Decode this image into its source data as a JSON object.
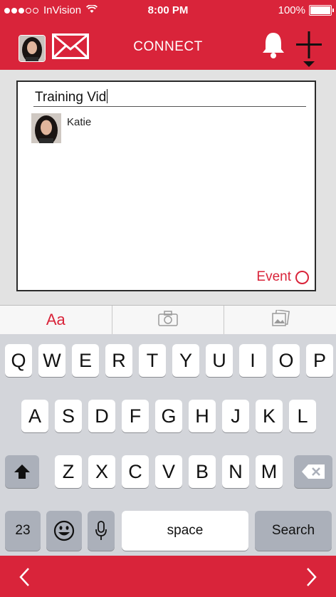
{
  "status_bar": {
    "carrier": "InVision",
    "time": "8:00 PM",
    "battery": "100%",
    "battery_level": 1.0,
    "signal_dots_filled": 3,
    "signal_dots_total": 5
  },
  "nav": {
    "title": "CONNECT"
  },
  "compose": {
    "input_value": "Training Vid",
    "suggestion_name": "Katie",
    "event_label": "Event"
  },
  "toolbar": {
    "text_format_label": "Aa"
  },
  "keyboard": {
    "row1": [
      "Q",
      "W",
      "E",
      "R",
      "T",
      "Y",
      "U",
      "I",
      "O",
      "P"
    ],
    "row2": [
      "A",
      "S",
      "D",
      "F",
      "G",
      "H",
      "J",
      "K",
      "L"
    ],
    "row3": [
      "Z",
      "X",
      "C",
      "V",
      "B",
      "N",
      "M"
    ],
    "numbers_label": "23",
    "space_label": "space",
    "search_label": "Search"
  },
  "colors": {
    "brand": "#d9243a",
    "keyboard_bg": "#d3d5da"
  }
}
